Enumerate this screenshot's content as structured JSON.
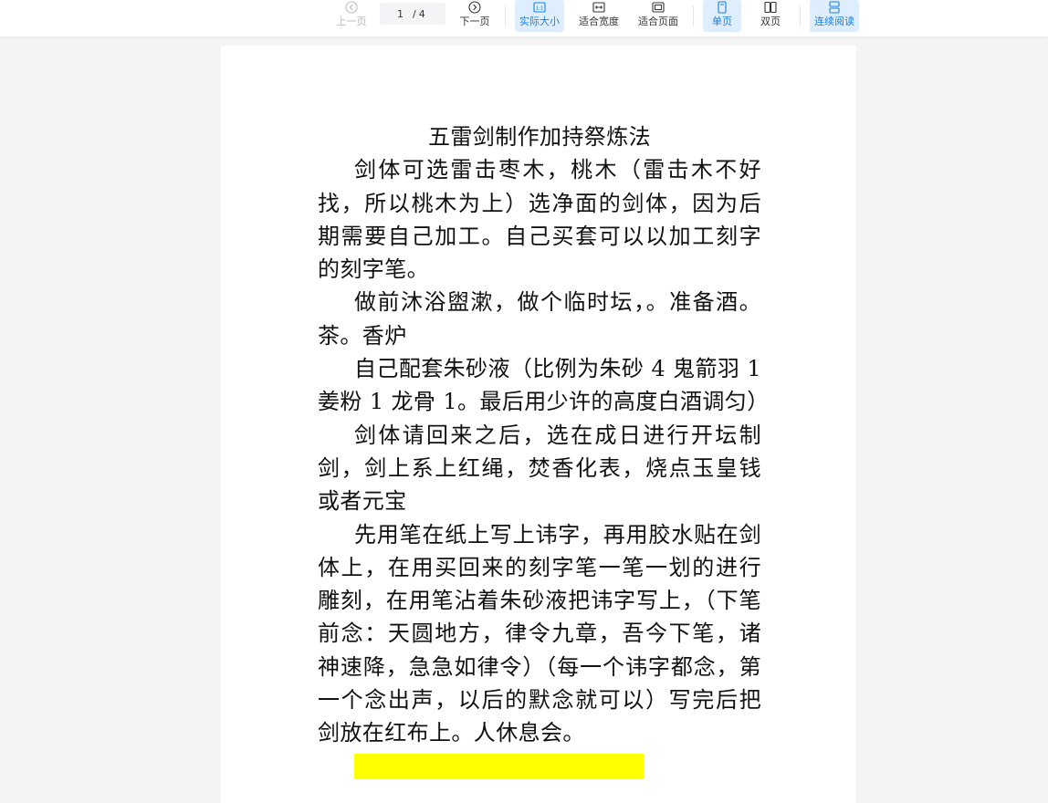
{
  "toolbar": {
    "prev_label": "上一页",
    "page_current": "1",
    "page_separator": "/",
    "page_total": "4",
    "next_label": "下一页",
    "actual_size_label": "实际大小",
    "fit_width_label": "适合宽度",
    "fit_page_label": "适合页面",
    "single_page_label": "单页",
    "double_page_label": "双页",
    "continuous_label": "连续阅读",
    "accent_color": "#1a7fe0",
    "active_bg": "#dfeefc"
  },
  "document": {
    "title": "五雷剑制作加持祭炼法",
    "paragraphs": [
      "剑体可选雷击枣木，桃木（雷击木不好找，所以桃木为上）选净面的剑体，因为后期需要自己加工。自己买套可以以加工刻字的刻字笔。",
      "做前沐浴盥漱，做个临时坛，。准备酒。茶。香炉",
      "自己配套朱砂液（比例为朱砂 4 鬼箭羽 1 姜粉 1 龙骨 1。最后用少许的高度白酒调匀）",
      "剑体请回来之后，选在成日进行开坛制剑，剑上系上红绳，焚香化表，烧点玉皇钱或者元宝",
      "先用笔在纸上写上讳字，再用胶水贴在剑体上，在用买回来的刻字笔一笔一划的进行雕刻，在用笔沾着朱砂液把讳字写上，（下笔前念：天圆地方，律令九章，吾今下笔，诸神速降，急急如律令）（每一个讳字都念，第一个念出声，以后的默念就可以）写完后把剑放在红布上。人休息会。"
    ],
    "highlight_color": "#ffff00"
  }
}
